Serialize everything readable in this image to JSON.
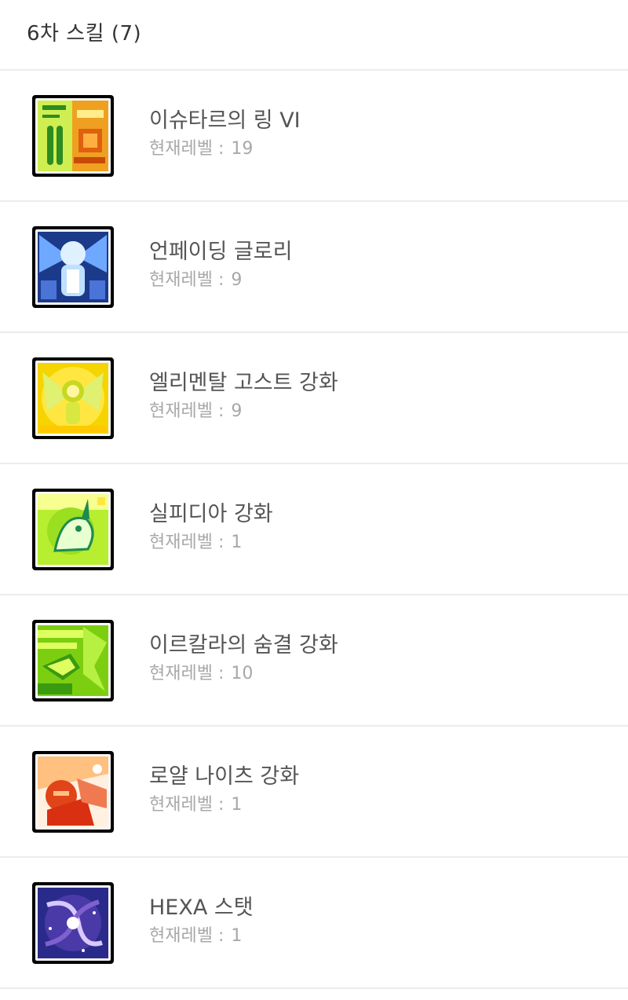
{
  "header": {
    "title": "6차 스킬 (7)"
  },
  "skills": [
    {
      "name": "이슈타르의 링 VI",
      "level_label": "현재레벨 : ",
      "level": "19",
      "icon": "ishtar-ring-icon",
      "colors": [
        "#2e8b1f",
        "#f0a020",
        "#c8f040"
      ]
    },
    {
      "name": "언페이딩 글로리",
      "level_label": "현재레벨 : ",
      "level": "9",
      "icon": "unfading-glory-icon",
      "colors": [
        "#1c3a8a",
        "#bfe0ff",
        "#ffffff"
      ]
    },
    {
      "name": "엘리멘탈 고스트 강화",
      "level_label": "현재레벨 : ",
      "level": "9",
      "icon": "elemental-ghost-icon",
      "colors": [
        "#f5d400",
        "#e0f070",
        "#fff6a0"
      ]
    },
    {
      "name": "실피디아 강화",
      "level_label": "현재레벨 : ",
      "level": "1",
      "icon": "sylphidia-icon",
      "colors": [
        "#9adf20",
        "#1e8a50",
        "#f6ff90"
      ]
    },
    {
      "name": "이르칼라의 숨결 강화",
      "level_label": "현재레벨 : ",
      "level": "10",
      "icon": "irkalla-breath-icon",
      "colors": [
        "#7ccf10",
        "#dfff60",
        "#3a9a10"
      ]
    },
    {
      "name": "로얄 나이츠 강화",
      "level_label": "현재레벨 : ",
      "level": "1",
      "icon": "royal-knights-icon",
      "colors": [
        "#e04418",
        "#ffc080",
        "#fff0e0"
      ]
    },
    {
      "name": "HEXA 스탯",
      "level_label": "현재레벨 : ",
      "level": "1",
      "icon": "hexa-stat-icon",
      "colors": [
        "#2a2a8a",
        "#8060d0",
        "#d8c8ff"
      ]
    }
  ]
}
